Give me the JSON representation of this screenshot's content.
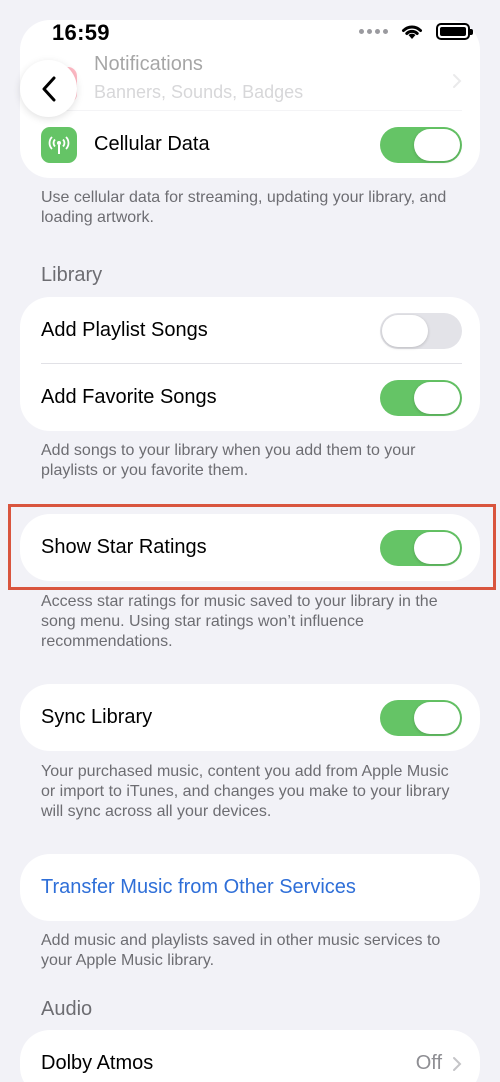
{
  "status_bar": {
    "time": "16:59"
  },
  "notifications_row": {
    "label": "Notifications",
    "sublabel": "Banners, Sounds, Badges"
  },
  "cellular": {
    "label": "Cellular Data",
    "toggle_on": true,
    "footnote": "Use cellular data for streaming, updating your library, and loading artwork."
  },
  "library": {
    "header": "Library",
    "add_playlist_songs": {
      "label": "Add Playlist Songs",
      "toggle_on": false
    },
    "add_favorite_songs": {
      "label": "Add Favorite Songs",
      "toggle_on": true
    },
    "footnote": "Add songs to your library when you add them to your playlists or you favorite them."
  },
  "star_ratings": {
    "label": "Show Star Ratings",
    "toggle_on": true,
    "footnote": "Access star ratings for music saved to your library in the song menu. Using star ratings won’t influence recommendations."
  },
  "sync_library": {
    "label": "Sync Library",
    "toggle_on": true,
    "footnote": "Your purchased music, content you add from Apple Music or import to iTunes, and changes you make to your library will sync across all your devices."
  },
  "transfer": {
    "label": "Transfer Music from Other Services",
    "footnote": "Add music and playlists saved in other music services to your Apple Music library."
  },
  "audio": {
    "header": "Audio",
    "dolby_atmos": {
      "label": "Dolby Atmos",
      "value": "Off"
    }
  },
  "colors": {
    "accent_link": "#2f6fd8",
    "toggle_on": "#65c466",
    "highlight": "#d9553e"
  }
}
